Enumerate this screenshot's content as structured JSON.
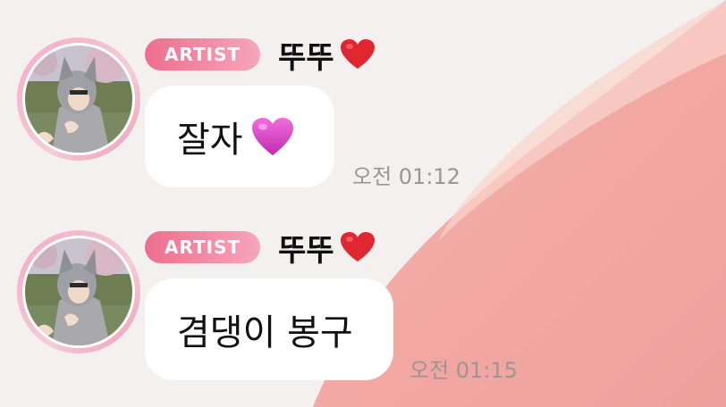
{
  "messages": [
    {
      "badge": "ARTIST",
      "sender": "뚜뚜",
      "text": "잘자",
      "time": "오전 01:12",
      "has_heart_emoji": true
    },
    {
      "badge": "ARTIST",
      "sender": "뚜뚜",
      "text": "겸댕이 봉구",
      "time": "오전 01:15",
      "has_heart_emoji": false
    }
  ],
  "colors": {
    "badge_start": "#ec6f8e",
    "badge_end": "#f6a6bb",
    "red_heart": "#e0262f",
    "purple_heart": "#d53ec2",
    "background_pink": "#f2a9a6"
  },
  "icons": {
    "name_heart": "red-heart-icon",
    "message_heart": "pink-heart-icon"
  }
}
